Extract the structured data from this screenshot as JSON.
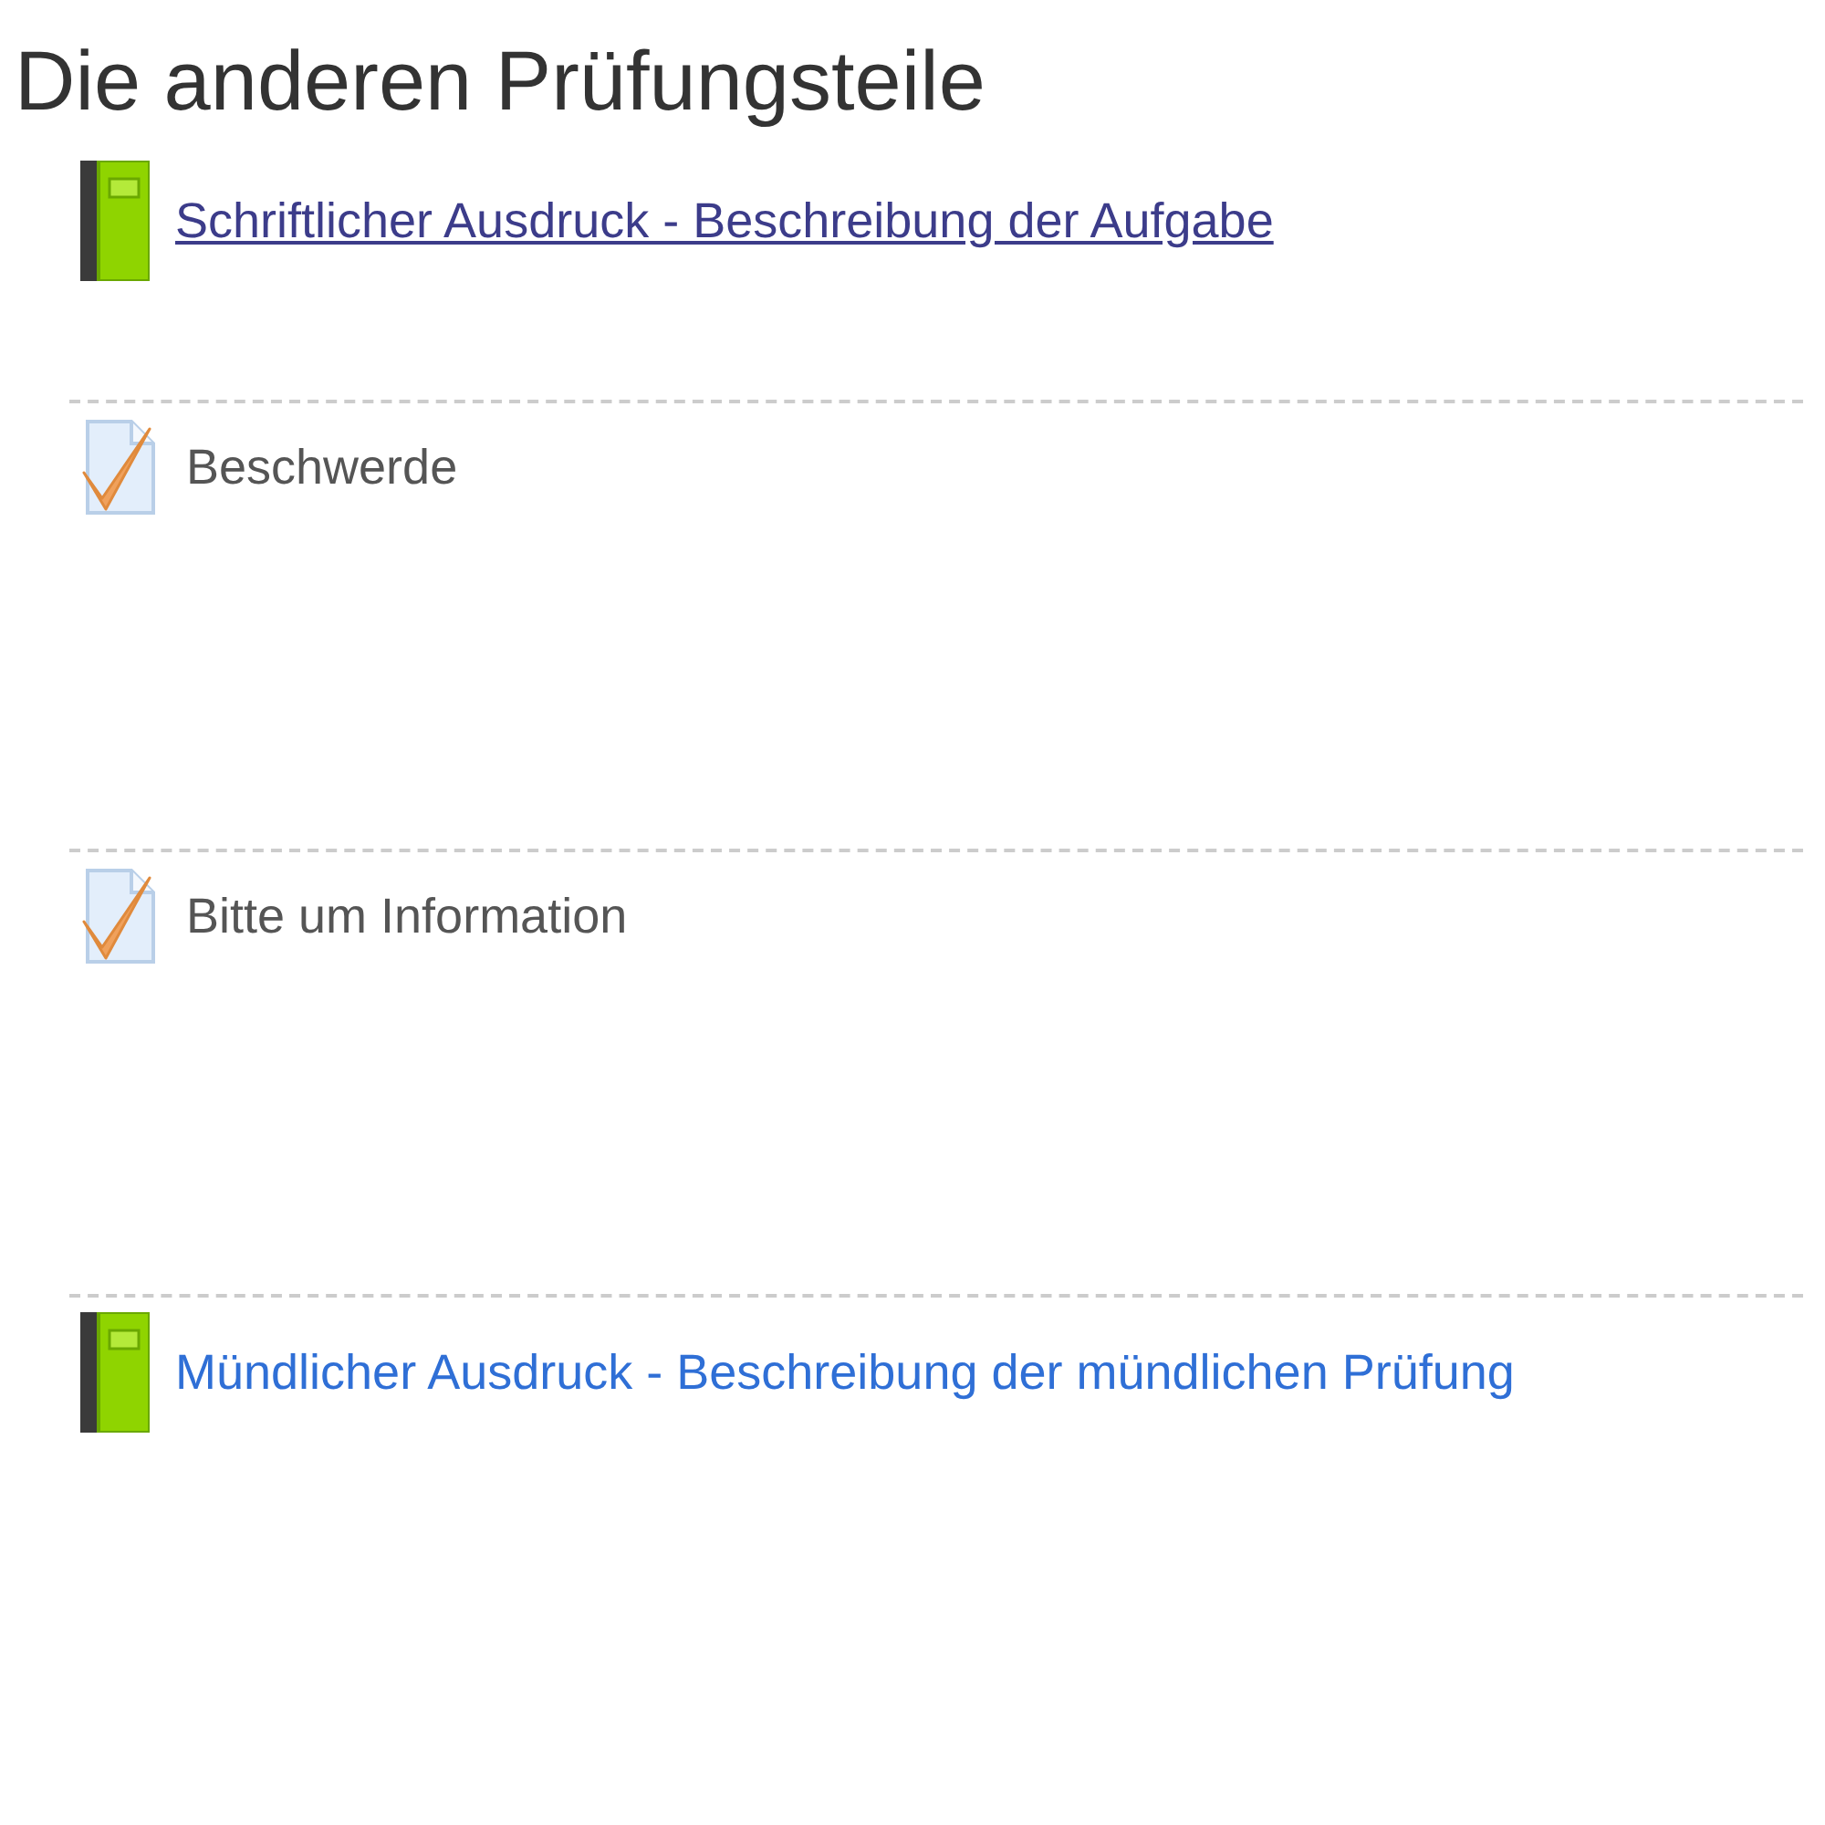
{
  "heading": "Die anderen Prüfungsteile",
  "items": [
    {
      "kind": "book",
      "label": "Schriftlicher Ausdruck - Beschreibung der Aufgabe",
      "visited": true
    },
    {
      "kind": "assignment",
      "label": "Beschwerde",
      "visited": false
    },
    {
      "kind": "assignment",
      "label": "Bitte um Information",
      "visited": false
    },
    {
      "kind": "book",
      "label": "Mündlicher Ausdruck - Beschreibung der mündlichen Prüfung",
      "visited": false
    }
  ]
}
